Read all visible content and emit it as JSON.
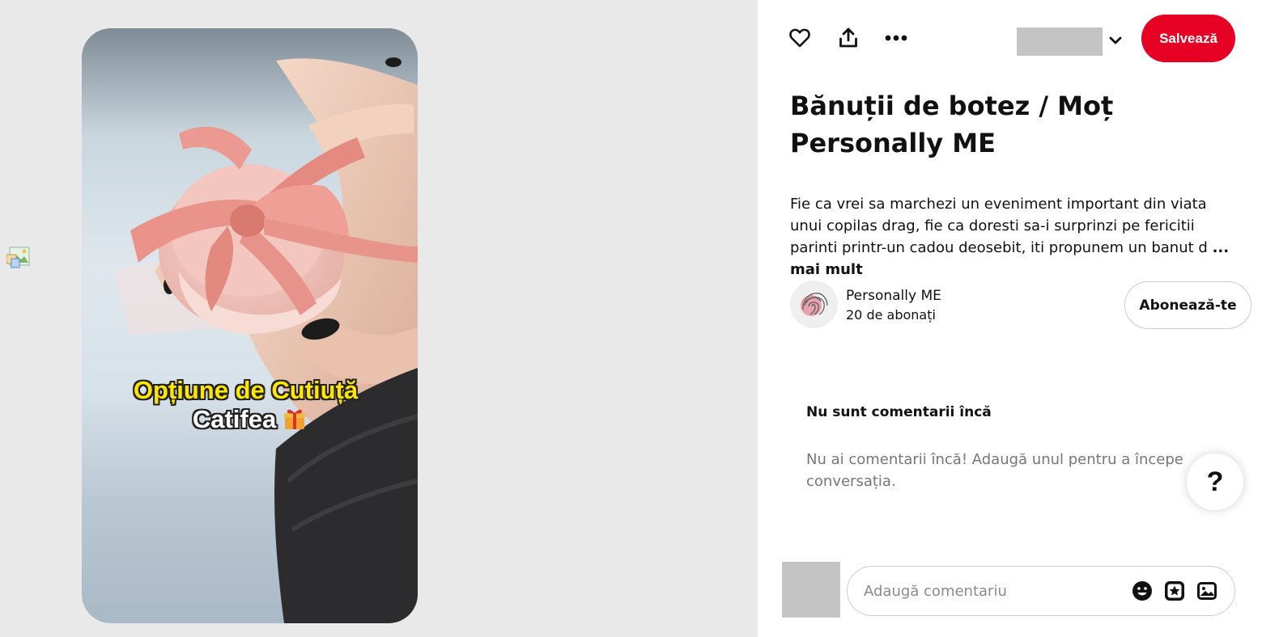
{
  "media": {
    "overlay_line1": "Opțiune de Cutiuță",
    "overlay_line2": "Catifea"
  },
  "toolbar": {
    "like_icon": "heart-icon",
    "share_icon": "share-icon",
    "more_icon": "more-icon",
    "save_label": "Salvează"
  },
  "pin": {
    "title": "Bănuții de botez / Moț Personally ME",
    "description": "Fie ca vrei sa marchezi un eveniment important din viata unui copilas drag, fie ca doresti sa-i surprinzi pe fericitii parinti printr-un cadou deosebit, iti propunem un banut d",
    "more_label": "... mai mult"
  },
  "author": {
    "name": "Personally ME",
    "followers": "20 de abonați",
    "follow_label": "Abonează-te"
  },
  "comments": {
    "heading": "Nu sunt comentarii încă",
    "empty_text": "Nu ai comentarii încă! Adaugă unul pentru a începe conversația.",
    "placeholder": "Adaugă comentariu"
  },
  "help": {
    "label": "?"
  },
  "colors": {
    "save_button": "#e60023",
    "panel_background": "#ffffff",
    "page_background": "#e9e9e9"
  }
}
